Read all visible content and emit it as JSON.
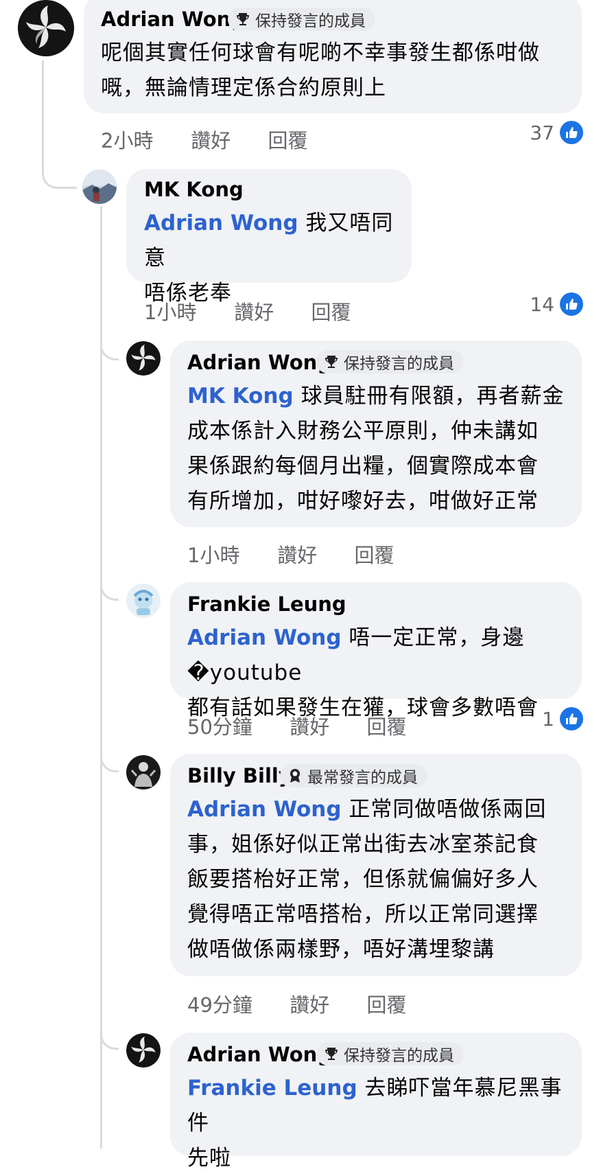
{
  "badges": {
    "keep": "保持發言的成員",
    "top": "最常發言的成員"
  },
  "actions": {
    "like": "讚好",
    "reply": "回覆"
  },
  "comments": [
    {
      "author": "Adrian Wong",
      "badge": "保持發言的成員",
      "lines": [
        "呢個其實任何球會有呢啲不幸事發生都係咁做",
        "嘅，無論情理定係合約原則上"
      ],
      "time": "2小時",
      "likes": "37"
    },
    {
      "author": "MK Kong",
      "mention": "Adrian Wong",
      "lines": [
        "我又唔同意",
        "唔係老奉"
      ],
      "time": "1小時",
      "likes": "14"
    },
    {
      "author": "Adrian Wong",
      "badge": "保持發言的成員",
      "mention": "MK Kong",
      "lines": [
        "球員駐冊有限額，再者薪金",
        "成本係計入財務公平原則，仲未講如",
        "果係跟約每個月出糧，個實際成本會",
        "有所增加，咁好嚟好去，咁做好正常"
      ],
      "time": "1小時"
    },
    {
      "author": "Frankie Leung",
      "mention": "Adrian Wong",
      "lines": [
        "唔一定正常，身邊�youtube",
        "都有話如果發生在獾，球會多數唔會"
      ],
      "time": "50分鐘",
      "likes": "1"
    },
    {
      "author": "Billy Billy",
      "badge": "最常發言的成員",
      "mention": "Adrian Wong",
      "lines": [
        "正常同做唔做係兩回",
        "事，姐係好似正常出街去冰室茶記食",
        "飯要搭枱好正常，但係就偏偏好多人",
        "覺得唔正常唔搭枱，所以正常同選擇",
        "做唔做係兩樣野，唔好溝埋黎講"
      ],
      "time": "49分鐘"
    },
    {
      "author": "Adrian Wong",
      "badge": "保持發言的成員",
      "mention": "Frankie Leung",
      "lines": [
        "去睇吓當年慕尼黑事件",
        "先啦"
      ]
    }
  ]
}
